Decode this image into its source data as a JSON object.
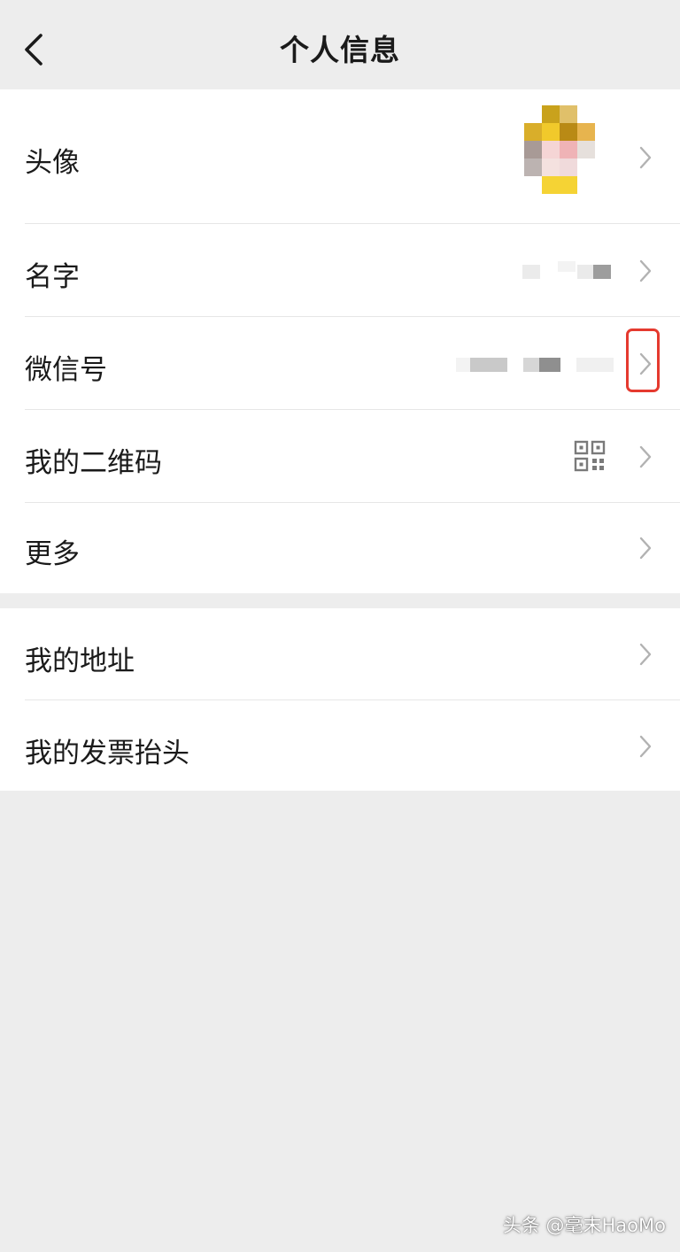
{
  "header": {
    "title": "个人信息",
    "back_icon": "chevron-left-icon"
  },
  "profile": {
    "items": [
      {
        "label": "头像",
        "value": "avatar-image-pixelated"
      },
      {
        "label": "名字",
        "value": "pixelated-name"
      },
      {
        "label": "微信号",
        "value": "pixelated-wechat-id"
      },
      {
        "label": "我的二维码",
        "value": "qr-code-icon"
      },
      {
        "label": "更多"
      }
    ]
  },
  "extras": {
    "items": [
      {
        "label": "我的地址"
      },
      {
        "label": "我的发票抬头"
      }
    ]
  },
  "annotation": {
    "highlight_color": "#e53a2f"
  },
  "watermark": {
    "text": "头条 @毫末HaoMo"
  },
  "colors": {
    "background": "#ededed",
    "card": "#ffffff",
    "chevron": "#b2b2b2"
  }
}
